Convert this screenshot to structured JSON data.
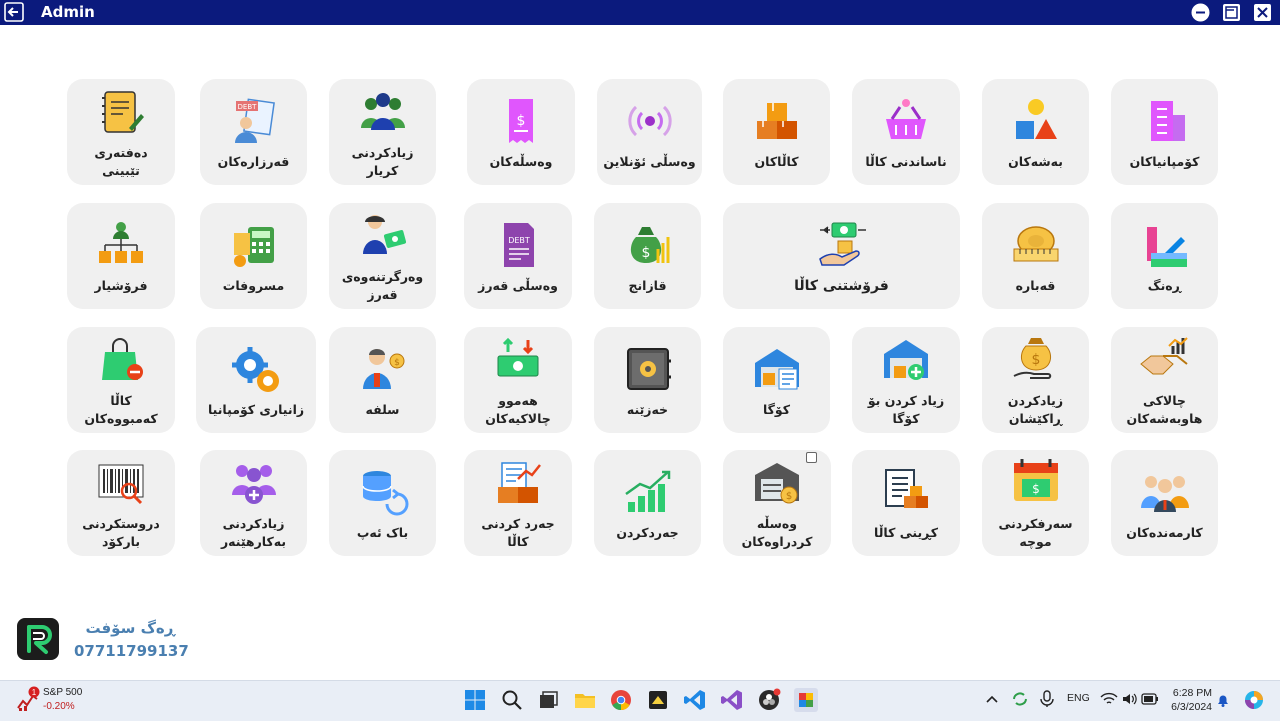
{
  "window": {
    "title": "Admin",
    "colors": {
      "titlebar": "#0b1a7d",
      "tile_bg": "#f0f0f0",
      "brand_text": "#4a7fb0"
    }
  },
  "tiles": [
    {
      "label": "دەفتەری\nتێبینی",
      "icon": "notebook-icon"
    },
    {
      "label": "قەرزارەکان",
      "icon": "debt-people-icon"
    },
    {
      "label": "زیادکردنی\nکریار",
      "icon": "customers-icon"
    },
    {
      "label": "وەسڵەکان",
      "icon": "receipt-icon"
    },
    {
      "label": "وەسڵی ئۆنلاین",
      "icon": "online-broadcast-icon"
    },
    {
      "label": "کاڵاکان",
      "icon": "boxes-icon"
    },
    {
      "label": "ناساندنی کاڵا",
      "icon": "basket-icon"
    },
    {
      "label": "بەشەکان",
      "icon": "shapes-icon"
    },
    {
      "label": "کۆمپانیاکان",
      "icon": "company-building-icon"
    },
    {
      "label": "فرۆشیار",
      "icon": "seller-hierarchy-icon"
    },
    {
      "label": "مسروفات",
      "icon": "expenses-calculator-icon"
    },
    {
      "label": "وەرگرتنەوەی\nقەرز",
      "icon": "debt-collection-icon"
    },
    {
      "label": "وەسڵی قەرز",
      "icon": "debt-receipt-icon"
    },
    {
      "label": "قازانج",
      "icon": "profit-moneybag-icon"
    },
    {
      "label": "فرۆشتنی کاڵا",
      "icon": "sell-goods-icon"
    },
    {
      "label": "قەبارە",
      "icon": "tape-measure-icon"
    },
    {
      "label": "ڕەنگ",
      "icon": "color-palette-icon"
    },
    {
      "label": "کاڵا\nکەمبووەکان",
      "icon": "shopping-bag-minus-icon"
    },
    {
      "label": "زانیاری کۆمپانیا",
      "icon": "settings-gears-icon"
    },
    {
      "label": "سلفە",
      "icon": "advance-person-icon"
    },
    {
      "label": "هەموو\nچالاکیەکان",
      "icon": "money-transfer-icon"
    },
    {
      "label": "خەزێنە",
      "icon": "safe-icon"
    },
    {
      "label": "کۆگا",
      "icon": "warehouse-icon"
    },
    {
      "label": "زیاد کردن بۆ کۆگا",
      "icon": "warehouse-add-icon"
    },
    {
      "label": "زیادکردن\nڕاکێشان",
      "icon": "money-hand-icon"
    },
    {
      "label": "چالاکی\nهاوبەشەکان",
      "icon": "handshake-icon"
    },
    {
      "label": "دروستکردنی\nبارکۆد",
      "icon": "barcode-icon"
    },
    {
      "label": "زیادکردنی\nبەکارهێنەر",
      "icon": "add-user-icon"
    },
    {
      "label": "باک ئەپ",
      "icon": "backup-database-icon"
    },
    {
      "label": "جەرد کردنی\nکاڵا",
      "icon": "inventory-chart-icon"
    },
    {
      "label": "جەردکردن",
      "icon": "growth-chart-icon"
    },
    {
      "label": "وەسڵە\nکردراوەکان",
      "icon": "store-money-icon"
    },
    {
      "label": "کڕینی کاڵا",
      "icon": "purchase-list-icon"
    },
    {
      "label": "سەرفکردنی\nموچە",
      "icon": "salary-calendar-icon"
    },
    {
      "label": "کارمەندەکان",
      "icon": "employees-icon"
    }
  ],
  "brand": {
    "name": "ڕەگ سۆفت",
    "phone": "07711799137"
  },
  "taskbar": {
    "stock_name": "S&P 500",
    "stock_change": "-0.20%",
    "stock_badge": "1",
    "language": "ENG",
    "time": "6:28 PM",
    "date": "6/3/2024"
  }
}
